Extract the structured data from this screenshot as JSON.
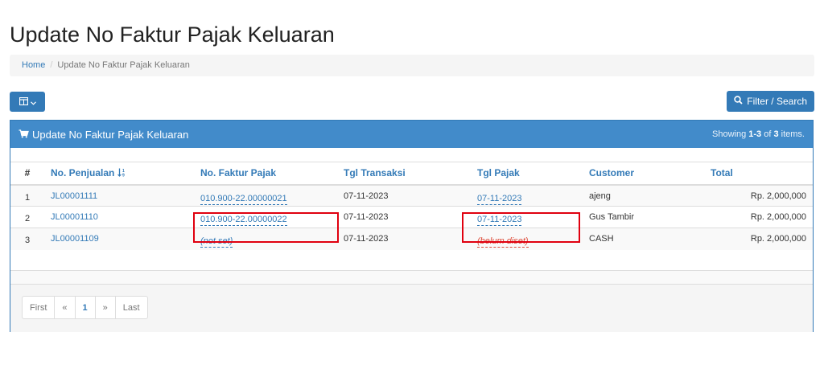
{
  "page": {
    "title": "Update No Faktur Pajak Keluaran"
  },
  "breadcrumb": {
    "home": "Home",
    "separator": "/",
    "current": "Update No Faktur Pajak Keluaran"
  },
  "toolbar": {
    "columns_icon": "grid-columns-icon",
    "filter_label": "Filter / Search",
    "filter_icon": "search-icon"
  },
  "panel": {
    "title": "Update No Faktur Pajak Keluaran",
    "title_icon": "cart-icon",
    "summary_prefix": "Showing ",
    "summary_range": "1-3",
    "summary_of": " of ",
    "summary_total": "3",
    "summary_suffix": " items."
  },
  "table": {
    "headers": {
      "num": "#",
      "no_penjualan": "No. Penjualan",
      "no_faktur": "No. Faktur Pajak",
      "tgl_transaksi": "Tgl Transaksi",
      "tgl_pajak": "Tgl Pajak",
      "customer": "Customer",
      "total": "Total"
    },
    "sort_icon": "sort-ascending-icon",
    "rows": [
      {
        "num": "1",
        "no_penjualan": "JL00001111",
        "no_faktur": "010.900-22.00000021",
        "tgl_transaksi": "07-11-2023",
        "tgl_pajak": "07-11-2023",
        "customer": "ajeng",
        "total": "Rp. 2,000,000"
      },
      {
        "num": "2",
        "no_penjualan": "JL00001110",
        "no_faktur": "010.900-22.00000022",
        "tgl_transaksi": "07-11-2023",
        "tgl_pajak": "07-11-2023",
        "customer": "Gus Tambir",
        "total": "Rp. 2,000,000"
      },
      {
        "num": "3",
        "no_penjualan": "JL00001109",
        "no_faktur": "(not set)",
        "tgl_transaksi": "07-11-2023",
        "tgl_pajak": "(belum diset)",
        "customer": "CASH",
        "total": "Rp. 2,000,000"
      }
    ]
  },
  "pager": {
    "first": "First",
    "prev": "«",
    "current": "1",
    "next": "»",
    "last": "Last"
  },
  "colors": {
    "primary": "#337ab7",
    "panel_heading": "#428bca",
    "highlight": "#e0000f",
    "danger": "#dd4b39"
  }
}
